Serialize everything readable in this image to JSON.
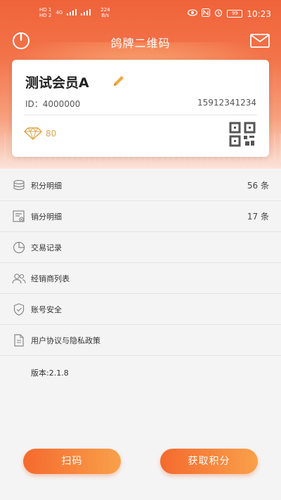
{
  "status_bar": {
    "sim1": "HD 1",
    "sim2": "HD 2",
    "network": "4G",
    "speed_value": "224",
    "speed_unit": "B/s",
    "battery": "99",
    "time": "10:23"
  },
  "header": {
    "title": "鸽牌二维码"
  },
  "member": {
    "name": "测试会员A",
    "id_text": "ID：4000000",
    "phone": "15912341234",
    "points": "80"
  },
  "menu": [
    {
      "label": "积分明细",
      "count": "56 条",
      "icon": "coins-icon"
    },
    {
      "label": "销分明细",
      "count": "17 条",
      "icon": "receipt-icon"
    },
    {
      "label": "交易记录",
      "count": "",
      "icon": "pie-chart-icon"
    },
    {
      "label": "经销商列表",
      "count": "",
      "icon": "users-icon"
    },
    {
      "label": "账号安全",
      "count": "",
      "icon": "shield-icon"
    },
    {
      "label": "用户协议与隐私政策",
      "count": "",
      "icon": "document-icon"
    }
  ],
  "version": "版本:2.1.8",
  "buttons": {
    "scan": "扫码",
    "get_points": "获取积分"
  },
  "colors": {
    "accent": "#f46a2e",
    "accent_end": "#f9a04a",
    "points_gold": "#e0a64a"
  }
}
